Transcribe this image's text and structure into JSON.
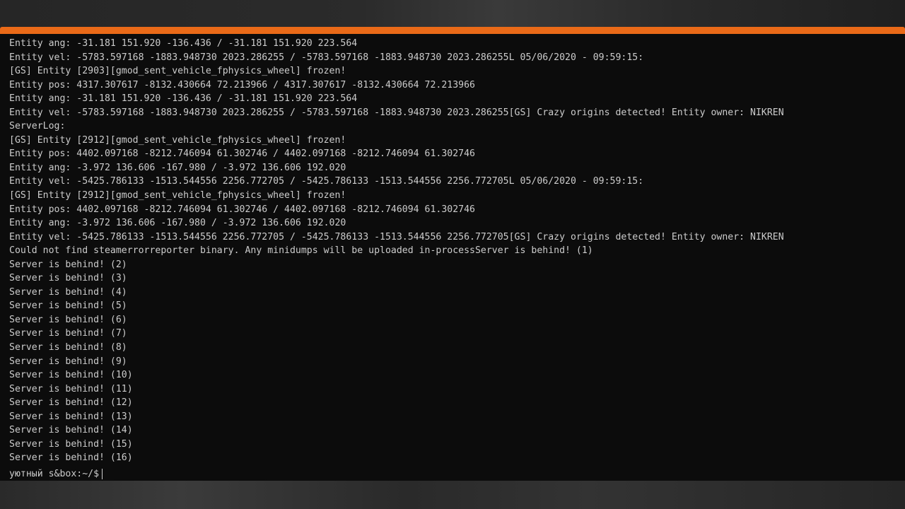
{
  "terminal": {
    "accent_color": "#ea6a18",
    "lines": [
      "Entity ang: -31.181 151.920 -136.436 / -31.181 151.920 223.564",
      "Entity vel: -5783.597168 -1883.948730 2023.286255 / -5783.597168 -1883.948730 2023.286255L 05/06/2020 - 09:59:15:",
      "[GS] Entity [2903][gmod_sent_vehicle_fphysics_wheel] frozen!",
      "Entity pos: 4317.307617 -8132.430664 72.213966 / 4317.307617 -8132.430664 72.213966",
      "Entity ang: -31.181 151.920 -136.436 / -31.181 151.920 223.564",
      "Entity vel: -5783.597168 -1883.948730 2023.286255 / -5783.597168 -1883.948730 2023.286255[GS] Crazy origins detected! Entity owner: NIKREN",
      "ServerLog:",
      "[GS] Entity [2912][gmod_sent_vehicle_fphysics_wheel] frozen!",
      "Entity pos: 4402.097168 -8212.746094 61.302746 / 4402.097168 -8212.746094 61.302746",
      "Entity ang: -3.972 136.606 -167.980 / -3.972 136.606 192.020",
      "Entity vel: -5425.786133 -1513.544556 2256.772705 / -5425.786133 -1513.544556 2256.772705L 05/06/2020 - 09:59:15:",
      "[GS] Entity [2912][gmod_sent_vehicle_fphysics_wheel] frozen!",
      "Entity pos: 4402.097168 -8212.746094 61.302746 / 4402.097168 -8212.746094 61.302746",
      "Entity ang: -3.972 136.606 -167.980 / -3.972 136.606 192.020",
      "Entity vel: -5425.786133 -1513.544556 2256.772705 / -5425.786133 -1513.544556 2256.772705[GS] Crazy origins detected! Entity owner: NIKREN",
      "Could not find steamerrorreporter binary. Any minidumps will be uploaded in-processServer is behind! (1)",
      "Server is behind! (2)",
      "Server is behind! (3)",
      "Server is behind! (4)",
      "Server is behind! (5)",
      "Server is behind! (6)",
      "Server is behind! (7)",
      "Server is behind! (8)",
      "Server is behind! (9)",
      "Server is behind! (10)",
      "Server is behind! (11)",
      "Server is behind! (12)",
      "Server is behind! (13)",
      "Server is behind! (14)",
      "Server is behind! (15)",
      "Server is behind! (16)"
    ],
    "prompt": "уютный s&box:~/$"
  }
}
